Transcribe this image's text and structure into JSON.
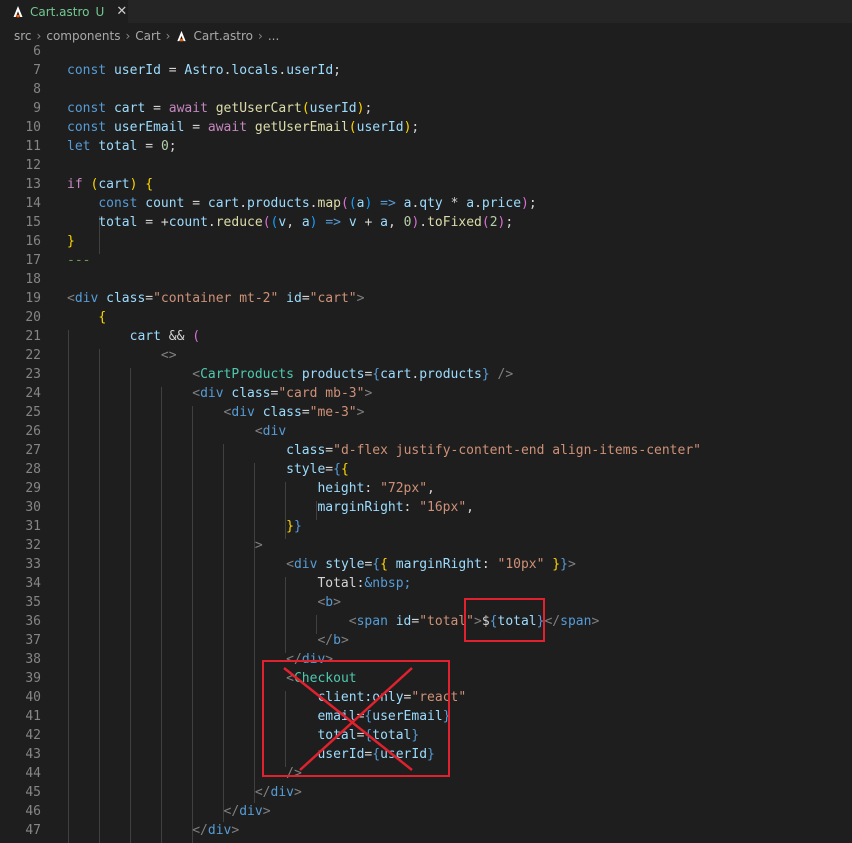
{
  "tab": {
    "filename": "Cart.astro",
    "status": "U",
    "close": "✕"
  },
  "breadcrumb": [
    "src",
    "components",
    "Cart",
    "Cart.astro",
    "..."
  ],
  "lines": [
    {
      "n": "6",
      "tokens": []
    },
    {
      "n": "7",
      "tokens": [
        [
          "k",
          "const "
        ],
        [
          "v",
          "userId"
        ],
        [
          "p",
          " = "
        ],
        [
          "v",
          "Astro"
        ],
        [
          "p",
          "."
        ],
        [
          "v",
          "locals"
        ],
        [
          "p",
          "."
        ],
        [
          "v",
          "userId"
        ],
        [
          "p",
          ";"
        ]
      ]
    },
    {
      "n": "8",
      "tokens": []
    },
    {
      "n": "9",
      "tokens": [
        [
          "k",
          "const "
        ],
        [
          "v",
          "cart"
        ],
        [
          "p",
          " = "
        ],
        [
          "kc",
          "await "
        ],
        [
          "f",
          "getUserCart"
        ],
        [
          "b1",
          "("
        ],
        [
          "v",
          "userId"
        ],
        [
          "b1",
          ")"
        ],
        [
          "p",
          ";"
        ]
      ]
    },
    {
      "n": "10",
      "tokens": [
        [
          "k",
          "const "
        ],
        [
          "v",
          "userEmail"
        ],
        [
          "p",
          " = "
        ],
        [
          "kc",
          "await "
        ],
        [
          "f",
          "getUserEmail"
        ],
        [
          "b1",
          "("
        ],
        [
          "v",
          "userId"
        ],
        [
          "b1",
          ")"
        ],
        [
          "p",
          ";"
        ]
      ]
    },
    {
      "n": "11",
      "tokens": [
        [
          "k",
          "let "
        ],
        [
          "v",
          "total"
        ],
        [
          "p",
          " = "
        ],
        [
          "n",
          "0"
        ],
        [
          "p",
          ";"
        ]
      ]
    },
    {
      "n": "12",
      "tokens": []
    },
    {
      "n": "13",
      "tokens": [
        [
          "kc",
          "if "
        ],
        [
          "b1",
          "("
        ],
        [
          "v",
          "cart"
        ],
        [
          "b1",
          ")"
        ],
        [
          "p",
          " "
        ],
        [
          "b1",
          "{"
        ]
      ]
    },
    {
      "n": "14",
      "tokens": [
        [
          "p",
          "    "
        ],
        [
          "k",
          "const "
        ],
        [
          "v",
          "count"
        ],
        [
          "p",
          " = "
        ],
        [
          "v",
          "cart"
        ],
        [
          "p",
          "."
        ],
        [
          "v",
          "products"
        ],
        [
          "p",
          "."
        ],
        [
          "f",
          "map"
        ],
        [
          "b2",
          "("
        ],
        [
          "b3",
          "("
        ],
        [
          "v",
          "a"
        ],
        [
          "b3",
          ")"
        ],
        [
          "p",
          " "
        ],
        [
          "k",
          "=>"
        ],
        [
          "p",
          " "
        ],
        [
          "v",
          "a"
        ],
        [
          "p",
          "."
        ],
        [
          "v",
          "qty"
        ],
        [
          "p",
          " * "
        ],
        [
          "v",
          "a"
        ],
        [
          "p",
          "."
        ],
        [
          "v",
          "price"
        ],
        [
          "b2",
          ")"
        ],
        [
          "p",
          ";"
        ]
      ]
    },
    {
      "n": "15",
      "tokens": [
        [
          "p",
          "    "
        ],
        [
          "v",
          "total"
        ],
        [
          "p",
          " = +"
        ],
        [
          "v",
          "count"
        ],
        [
          "p",
          "."
        ],
        [
          "f",
          "reduce"
        ],
        [
          "b2",
          "("
        ],
        [
          "b3",
          "("
        ],
        [
          "v",
          "v"
        ],
        [
          "p",
          ", "
        ],
        [
          "v",
          "a"
        ],
        [
          "b3",
          ")"
        ],
        [
          "p",
          " "
        ],
        [
          "k",
          "=>"
        ],
        [
          "p",
          " "
        ],
        [
          "v",
          "v"
        ],
        [
          "p",
          " + "
        ],
        [
          "v",
          "a"
        ],
        [
          "p",
          ", "
        ],
        [
          "n",
          "0"
        ],
        [
          "b2",
          ")"
        ],
        [
          "p",
          "."
        ],
        [
          "f",
          "toFixed"
        ],
        [
          "b2",
          "("
        ],
        [
          "n",
          "2"
        ],
        [
          "b2",
          ")"
        ],
        [
          "p",
          ";"
        ]
      ]
    },
    {
      "n": "16",
      "tokens": [
        [
          "b1",
          "}"
        ]
      ]
    },
    {
      "n": "17",
      "tokens": [
        [
          "cm",
          "---"
        ]
      ]
    },
    {
      "n": "18",
      "tokens": []
    },
    {
      "n": "19",
      "tokens": [
        [
          "tg",
          "<"
        ],
        [
          "t",
          "div"
        ],
        [
          "p",
          " "
        ],
        [
          "a",
          "class"
        ],
        [
          "p",
          "="
        ],
        [
          "s",
          "\"container mt-2\""
        ],
        [
          "p",
          " "
        ],
        [
          "a",
          "id"
        ],
        [
          "p",
          "="
        ],
        [
          "s",
          "\"cart\""
        ],
        [
          "tg",
          ">"
        ]
      ]
    },
    {
      "n": "20",
      "tokens": [
        [
          "p",
          "    "
        ],
        [
          "b1",
          "{"
        ]
      ]
    },
    {
      "n": "21",
      "tokens": [
        [
          "p",
          "        "
        ],
        [
          "v",
          "cart"
        ],
        [
          "p",
          " && "
        ],
        [
          "b2",
          "("
        ]
      ]
    },
    {
      "n": "22",
      "tokens": [
        [
          "p",
          "            "
        ],
        [
          "tg",
          "<>"
        ]
      ]
    },
    {
      "n": "23",
      "tokens": [
        [
          "p",
          "                "
        ],
        [
          "tg",
          "<"
        ],
        [
          "c",
          "CartProducts"
        ],
        [
          "p",
          " "
        ],
        [
          "a",
          "products"
        ],
        [
          "p",
          "="
        ],
        [
          "t",
          "{"
        ],
        [
          "v",
          "cart"
        ],
        [
          "p",
          "."
        ],
        [
          "v",
          "products"
        ],
        [
          "t",
          "}"
        ],
        [
          "p",
          " "
        ],
        [
          "tg",
          "/>"
        ]
      ]
    },
    {
      "n": "24",
      "tokens": [
        [
          "p",
          "                "
        ],
        [
          "tg",
          "<"
        ],
        [
          "t",
          "div"
        ],
        [
          "p",
          " "
        ],
        [
          "a",
          "class"
        ],
        [
          "p",
          "="
        ],
        [
          "s",
          "\"card mb-3\""
        ],
        [
          "tg",
          ">"
        ]
      ]
    },
    {
      "n": "25",
      "tokens": [
        [
          "p",
          "                    "
        ],
        [
          "tg",
          "<"
        ],
        [
          "t",
          "div"
        ],
        [
          "p",
          " "
        ],
        [
          "a",
          "class"
        ],
        [
          "p",
          "="
        ],
        [
          "s",
          "\"me-3\""
        ],
        [
          "tg",
          ">"
        ]
      ]
    },
    {
      "n": "26",
      "tokens": [
        [
          "p",
          "                        "
        ],
        [
          "tg",
          "<"
        ],
        [
          "t",
          "div"
        ]
      ]
    },
    {
      "n": "27",
      "tokens": [
        [
          "p",
          "                            "
        ],
        [
          "a",
          "class"
        ],
        [
          "p",
          "="
        ],
        [
          "s",
          "\"d-flex justify-content-end align-items-center\""
        ]
      ]
    },
    {
      "n": "28",
      "tokens": [
        [
          "p",
          "                            "
        ],
        [
          "a",
          "style"
        ],
        [
          "p",
          "="
        ],
        [
          "t",
          "{"
        ],
        [
          "b1",
          "{"
        ]
      ]
    },
    {
      "n": "29",
      "tokens": [
        [
          "p",
          "                                "
        ],
        [
          "v",
          "height"
        ],
        [
          "p",
          ": "
        ],
        [
          "s",
          "\"72px\""
        ],
        [
          "p",
          ","
        ]
      ]
    },
    {
      "n": "30",
      "tokens": [
        [
          "p",
          "                                "
        ],
        [
          "v",
          "marginRight"
        ],
        [
          "p",
          ": "
        ],
        [
          "s",
          "\"16px\""
        ],
        [
          "p",
          ","
        ]
      ]
    },
    {
      "n": "31",
      "tokens": [
        [
          "p",
          "                            "
        ],
        [
          "b1",
          "}"
        ],
        [
          "t",
          "}"
        ]
      ]
    },
    {
      "n": "32",
      "tokens": [
        [
          "p",
          "                        "
        ],
        [
          "tg",
          ">"
        ]
      ]
    },
    {
      "n": "33",
      "tokens": [
        [
          "p",
          "                            "
        ],
        [
          "tg",
          "<"
        ],
        [
          "t",
          "div"
        ],
        [
          "p",
          " "
        ],
        [
          "a",
          "style"
        ],
        [
          "p",
          "="
        ],
        [
          "t",
          "{"
        ],
        [
          "b1",
          "{"
        ],
        [
          "p",
          " "
        ],
        [
          "v",
          "marginRight"
        ],
        [
          "p",
          ": "
        ],
        [
          "s",
          "\"10px\""
        ],
        [
          "p",
          " "
        ],
        [
          "b1",
          "}"
        ],
        [
          "t",
          "}"
        ],
        [
          "tg",
          ">"
        ]
      ]
    },
    {
      "n": "34",
      "tokens": [
        [
          "p",
          "                                "
        ],
        [
          "tx",
          "Total:"
        ],
        [
          "k",
          "&nbsp;"
        ]
      ]
    },
    {
      "n": "35",
      "tokens": [
        [
          "p",
          "                                "
        ],
        [
          "tg",
          "<"
        ],
        [
          "t",
          "b"
        ],
        [
          "tg",
          ">"
        ]
      ]
    },
    {
      "n": "36",
      "tokens": [
        [
          "p",
          "                                    "
        ],
        [
          "tg",
          "<"
        ],
        [
          "t",
          "span"
        ],
        [
          "p",
          " "
        ],
        [
          "a",
          "id"
        ],
        [
          "p",
          "="
        ],
        [
          "s",
          "\"total\""
        ],
        [
          "tg",
          ">"
        ],
        [
          "tx",
          "$"
        ],
        [
          "t",
          "{"
        ],
        [
          "v",
          "total"
        ],
        [
          "t",
          "}"
        ],
        [
          "tg",
          "</"
        ],
        [
          "t",
          "span"
        ],
        [
          "tg",
          ">"
        ]
      ]
    },
    {
      "n": "37",
      "tokens": [
        [
          "p",
          "                                "
        ],
        [
          "tg",
          "</"
        ],
        [
          "t",
          "b"
        ],
        [
          "tg",
          ">"
        ]
      ]
    },
    {
      "n": "38",
      "tokens": [
        [
          "p",
          "                            "
        ],
        [
          "tg",
          "</"
        ],
        [
          "t",
          "div"
        ],
        [
          "tg",
          ">"
        ]
      ]
    },
    {
      "n": "39",
      "tokens": [
        [
          "p",
          "                            "
        ],
        [
          "tg",
          "<"
        ],
        [
          "c",
          "Checkout"
        ]
      ]
    },
    {
      "n": "40",
      "tokens": [
        [
          "p",
          "                                "
        ],
        [
          "a",
          "client:only"
        ],
        [
          "p",
          "="
        ],
        [
          "s",
          "\"react\""
        ]
      ]
    },
    {
      "n": "41",
      "tokens": [
        [
          "p",
          "                                "
        ],
        [
          "a",
          "email"
        ],
        [
          "p",
          "="
        ],
        [
          "t",
          "{"
        ],
        [
          "v",
          "userEmail"
        ],
        [
          "t",
          "}"
        ]
      ]
    },
    {
      "n": "42",
      "tokens": [
        [
          "p",
          "                                "
        ],
        [
          "a",
          "total"
        ],
        [
          "p",
          "="
        ],
        [
          "t",
          "{"
        ],
        [
          "v",
          "total"
        ],
        [
          "t",
          "}"
        ]
      ]
    },
    {
      "n": "43",
      "tokens": [
        [
          "p",
          "                                "
        ],
        [
          "a",
          "userId"
        ],
        [
          "p",
          "="
        ],
        [
          "t",
          "{"
        ],
        [
          "v",
          "userId"
        ],
        [
          "t",
          "}"
        ]
      ]
    },
    {
      "n": "44",
      "tokens": [
        [
          "p",
          "                            "
        ],
        [
          "tg",
          "/>"
        ]
      ]
    },
    {
      "n": "45",
      "tokens": [
        [
          "p",
          "                        "
        ],
        [
          "tg",
          "</"
        ],
        [
          "t",
          "div"
        ],
        [
          "tg",
          ">"
        ]
      ]
    },
    {
      "n": "46",
      "tokens": [
        [
          "p",
          "                    "
        ],
        [
          "tg",
          "</"
        ],
        [
          "t",
          "div"
        ],
        [
          "tg",
          ">"
        ]
      ]
    },
    {
      "n": "47",
      "tokens": [
        [
          "p",
          "                "
        ],
        [
          "tg",
          "</"
        ],
        [
          "t",
          "div"
        ],
        [
          "tg",
          ">"
        ]
      ]
    }
  ],
  "colors": {
    "highlight_box": "#e0212e",
    "background": "#1e1e1e"
  },
  "icons": {
    "tab": "astro-icon",
    "breadcrumb": "astro-icon",
    "chevron": "chevron-right-icon"
  }
}
